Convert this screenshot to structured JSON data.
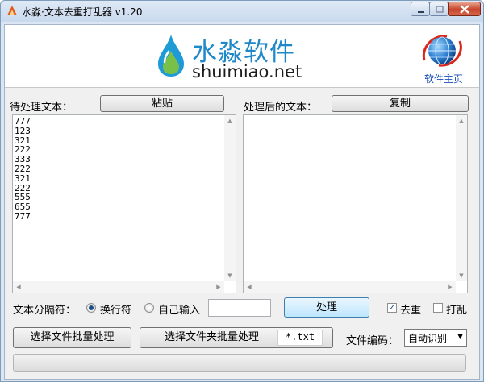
{
  "window": {
    "title": "水淼·文本去重打乱器 v1.20"
  },
  "banner": {
    "logo_cn": "水淼软件",
    "logo_en": "shuimiao.net",
    "home_link": "软件主页"
  },
  "source": {
    "label": "待处理文本：",
    "paste_button": "粘贴",
    "text": "777\n123\n321\n222\n333\n222\n321\n222\n555\n655\n777"
  },
  "result": {
    "label": "处理后的文本：",
    "copy_button": "复制",
    "text": ""
  },
  "separator": {
    "label": "文本分隔符：",
    "options": [
      "换行符",
      "自己输入"
    ],
    "selected": "换行符",
    "custom_value": ""
  },
  "process_button": "处理",
  "options": {
    "dedupe_label": "去重",
    "dedupe_checked": true,
    "shuffle_label": "打乱",
    "shuffle_checked": false
  },
  "batch": {
    "file_button": "选择文件批量处理",
    "folder_button": "选择文件夹批量处理",
    "pattern": "*.txt",
    "encoding_label": "文件编码：",
    "encoding_selected": "自动识别"
  },
  "progress": 0,
  "colors": {
    "accent": "#1e88c8",
    "link": "#1a4fb8"
  }
}
